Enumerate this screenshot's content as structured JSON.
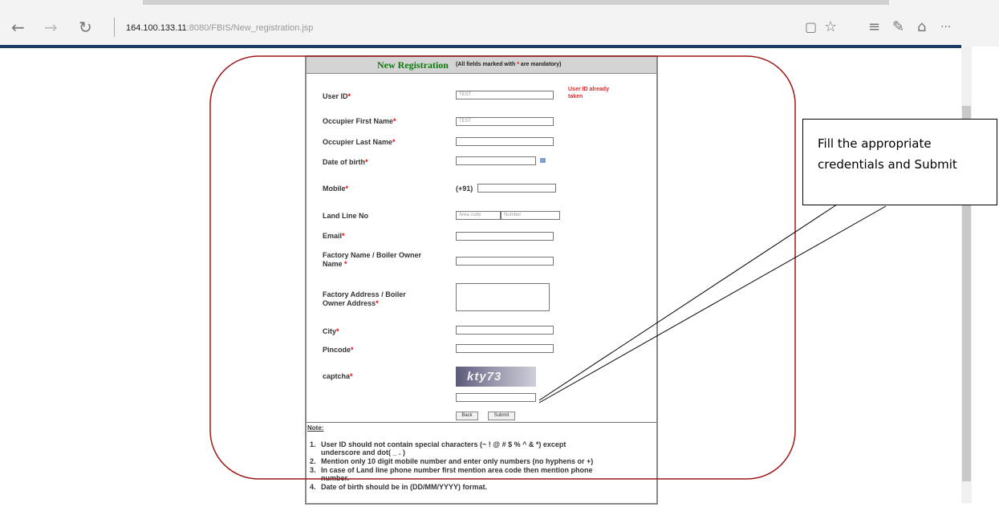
{
  "browser": {
    "nav": {
      "back_icon": "←",
      "forward_icon": "→",
      "refresh_icon": "↻"
    },
    "url": {
      "host": "164.100.133.11",
      "rest": ":8080/FBIS/New_registration.jsp"
    },
    "tools": {
      "reading_view_icon": "▢",
      "favorite_icon": "☆",
      "hub_icon": "≡",
      "note_icon": "✎",
      "share_icon": "⌂",
      "more_icon": "···"
    }
  },
  "form": {
    "title": "New Registration",
    "mandatory_note_prefix": "(All fields marked with ",
    "mandatory_star": "*",
    "mandatory_note_suffix": " are mandatory)",
    "fields": {
      "user_id": {
        "label": "User ID",
        "value": "TEST"
      },
      "first_name": {
        "label": "Occupier First Name",
        "value": "TEST"
      },
      "last_name": {
        "label": "Occupier Last Name",
        "value": ""
      },
      "dob": {
        "label": "Date of birth",
        "value": ""
      },
      "mobile": {
        "label": "Mobile",
        "prefix": "(+91)",
        "value": ""
      },
      "landline": {
        "label": "Land Line No",
        "area_placeholder": "Area code",
        "number_placeholder": "Number"
      },
      "email": {
        "label": "Email",
        "value": ""
      },
      "factory_name": {
        "label_line1": "Factory Name / Boiler Owner",
        "label_line2": "Name",
        "value": ""
      },
      "factory_address": {
        "label_line1": "Factory Address / Boiler",
        "label_line2": "Owner Address",
        "value": ""
      },
      "city": {
        "label": "City",
        "value": ""
      },
      "pincode": {
        "label": "Pincode",
        "value": ""
      },
      "captcha": {
        "label": "captcha",
        "image_text": "kty73",
        "value": ""
      }
    },
    "required_star": "*",
    "error_user_id_line1": "User ID already",
    "error_user_id_line2": "taken",
    "buttons": {
      "back": "Back",
      "submit": "Submit"
    },
    "notes": {
      "title": "Note:",
      "items": [
        {
          "num": "1.",
          "line1": "User ID should not contain special characters (~ ! @ # $ % ^ & *) except",
          "line2": "underscore and dot( _ . )"
        },
        {
          "num": "2.",
          "line1": "Mention only 10 digit mobile number and enter only numbers (no hyphens or +)"
        },
        {
          "num": "3.",
          "line1": "In case of Land line phone number first mention area code then mention phone",
          "line2": "number."
        },
        {
          "num": "4.",
          "line1": "Date of birth should be in (DD/MM/YYYY) format."
        }
      ]
    }
  },
  "callout": {
    "line1": "Fill the appropriate",
    "line2": "credentials and Submit"
  },
  "colors": {
    "annotation_outline": "#a01818",
    "header_title": "#0a7a0a",
    "error_text": "#e22222",
    "browser_accent": "#1b3a66"
  }
}
